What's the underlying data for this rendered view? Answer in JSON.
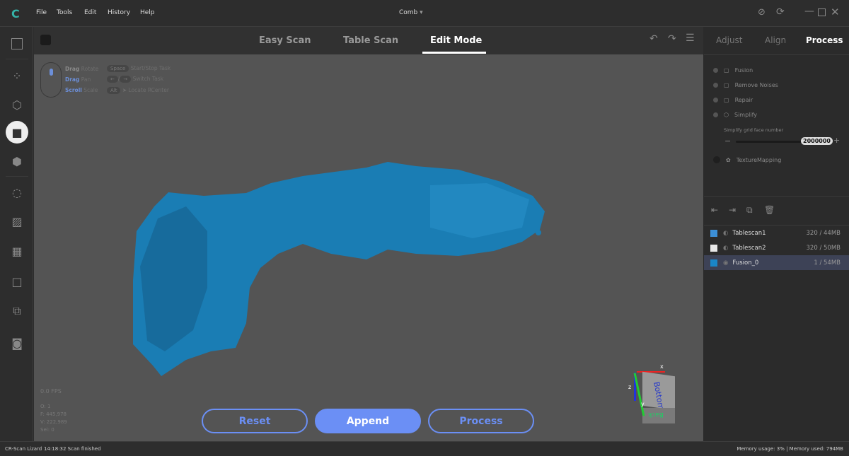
{
  "app": {
    "title": "Comb",
    "menu": [
      "File",
      "Tools",
      "Edit",
      "History",
      "Help"
    ]
  },
  "modes": [
    "Easy Scan",
    "Table Scan",
    "Edit Mode"
  ],
  "active_mode": "Edit Mode",
  "hints": {
    "drag1": "Drag",
    "rotate": "Rotate",
    "drag2": "Drag",
    "pan": "Pan",
    "scroll": "Scroll",
    "scale": "Scale",
    "space": "Space",
    "start_stop": "Start/Stop Task",
    "switch": "Switch Task",
    "alt": "Alt",
    "locate": "Locate RCenter"
  },
  "stats": {
    "fps": "0.0 FPS",
    "o": "O: 1",
    "f": "F: 445,978",
    "v": "V: 222,989",
    "sel": "Sel: 0"
  },
  "buttons": {
    "reset": "Reset",
    "append": "Append",
    "process": "Process"
  },
  "gizmo": {
    "top": "Bottom",
    "front": "Back",
    "x": "x",
    "y": "y",
    "z": "z"
  },
  "right_tabs": [
    "Adjust",
    "Align",
    "Process"
  ],
  "process_items": [
    "Fusion",
    "Remove Noises",
    "Repair",
    "Simplify"
  ],
  "simplify": {
    "label": "Simplify grid face number",
    "value": "2000000",
    "fraction": 0.95
  },
  "texture": "TextureMapping",
  "layers": [
    {
      "name": "Tablescan1",
      "size": "320 / 44MB",
      "color": "#3c8fd6"
    },
    {
      "name": "Tablescan2",
      "size": "320 / 50MB",
      "color": "#e8e8e8"
    },
    {
      "name": "Fusion_0",
      "size": "1 / 54MB",
      "color": "#1a86c8"
    }
  ],
  "status": {
    "app": "CR-Scan Lizard",
    "message": "14:18:32 Scan finished",
    "memory": "Memory usage: 3% | Memory used: 794MB"
  },
  "colors": {
    "accent": "#6b8ff5",
    "model": "#1a7db4"
  }
}
